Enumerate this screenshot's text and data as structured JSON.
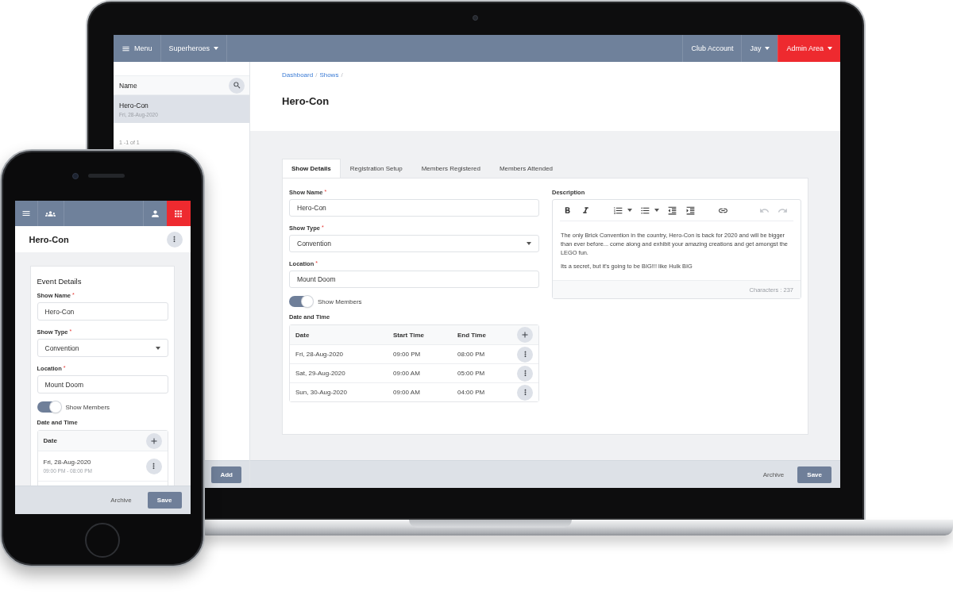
{
  "required_mark": "*",
  "laptop": {
    "nav": {
      "menu_label": "Menu",
      "club": "Superheroes",
      "links": [
        {
          "label": "Club Account",
          "kind": "link",
          "highlighted": false
        },
        {
          "label": "Jay",
          "kind": "dropdown",
          "highlighted": false
        },
        {
          "label": "Admin Area",
          "kind": "dropdown",
          "highlighted": true
        }
      ]
    },
    "sidebar": {
      "column_header": "Name",
      "items": [
        {
          "title": "Hero-Con",
          "subtitle": "Fri, 28-Aug-2020",
          "selected": true
        }
      ],
      "pagination": "1 -1 of 1",
      "add_button": "Add"
    },
    "breadcrumb": {
      "items": [
        "Dashboard",
        "Shows"
      ],
      "separator": "/"
    },
    "title": "Hero-Con",
    "tabs": [
      {
        "label": "Show Details",
        "selected": true
      },
      {
        "label": "Registration Setup",
        "selected": false
      },
      {
        "label": "Members Registered",
        "selected": false
      },
      {
        "label": "Members Attended",
        "selected": false
      }
    ],
    "form": {
      "fields": [
        {
          "label": "Show Name",
          "required": true,
          "kind": "text",
          "value": "Hero-Con"
        },
        {
          "label": "Show Type",
          "required": true,
          "kind": "select",
          "value": "Convention"
        },
        {
          "label": "Location",
          "required": true,
          "kind": "text",
          "value": "Mount Doom"
        }
      ],
      "toggle": {
        "label": "Show Members",
        "on": true
      },
      "schedule": {
        "title": "Date and Time",
        "columns": [
          "Date",
          "Start Time",
          "End Time"
        ],
        "rows": [
          {
            "date": "Fri, 28-Aug-2020",
            "start": "09:00 PM",
            "end": "08:00 PM"
          },
          {
            "date": "Sat, 29-Aug-2020",
            "start": "09:00 AM",
            "end": "05:00 PM"
          },
          {
            "date": "Sun, 30-Aug-2020",
            "start": "09:00 AM",
            "end": "04:00 PM"
          }
        ]
      }
    },
    "description": {
      "label": "Description",
      "toolbar": [
        {
          "tools": [
            {
              "kind": "bold",
              "dropdown": false,
              "disabled": false
            },
            {
              "kind": "italic",
              "dropdown": false,
              "disabled": false
            }
          ]
        },
        {
          "tools": [
            {
              "kind": "ordered-list",
              "dropdown": true,
              "disabled": false
            },
            {
              "kind": "bullet-list",
              "dropdown": true,
              "disabled": false
            },
            {
              "kind": "outdent",
              "dropdown": false,
              "disabled": false
            },
            {
              "kind": "indent",
              "dropdown": false,
              "disabled": false
            }
          ]
        },
        {
          "tools": [
            {
              "kind": "link",
              "dropdown": false,
              "disabled": false
            }
          ]
        },
        {
          "tools": [
            {
              "kind": "undo",
              "dropdown": false,
              "disabled": true
            },
            {
              "kind": "redo",
              "dropdown": false,
              "disabled": true
            }
          ]
        }
      ],
      "paragraphs": [
        "The only Brick Convention in the country, Hero-Con is back for 2020 and will be bigger than ever before... come along and exhibit your amazing creations and get amongst the LEGO fun.",
        "Its a secret, but it's going to be BIG!!! like Hulk BIG"
      ],
      "counter": "Characters : 237"
    },
    "footer": {
      "archive": "Archive",
      "save": "Save"
    }
  },
  "phone": {
    "title": "Hero-Con",
    "section_title": "Event Details",
    "fields": [
      {
        "label": "Show Name",
        "required": true,
        "kind": "text",
        "value": "Hero-Con"
      },
      {
        "label": "Show Type",
        "required": true,
        "kind": "select",
        "value": "Convention"
      },
      {
        "label": "Location",
        "required": true,
        "kind": "text",
        "value": "Mount Doom"
      }
    ],
    "toggle": {
      "label": "Show Members",
      "on": true
    },
    "schedule": {
      "title": "Date and Time",
      "column": "Date",
      "rows": [
        {
          "date": "Fri, 28-Aug-2020",
          "times": "09:00 PM - 08:00 PM"
        }
      ]
    },
    "footer": {
      "archive": "Archive",
      "save": "Save"
    }
  }
}
